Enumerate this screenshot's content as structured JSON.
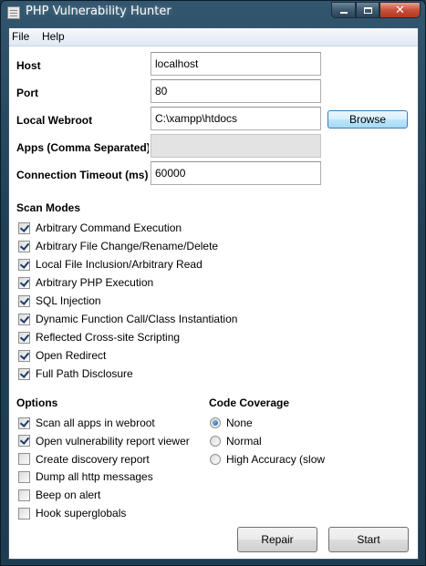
{
  "window": {
    "title": "PHP Vulnerability Hunter"
  },
  "menu": {
    "file": "File",
    "help": "Help"
  },
  "form": {
    "host_label": "Host",
    "host_value": "localhost",
    "port_label": "Port",
    "port_value": "80",
    "webroot_label": "Local Webroot",
    "webroot_value": "C:\\xampp\\htdocs",
    "browse_label": "Browse",
    "apps_label": "Apps (Comma Separated)",
    "apps_value": "",
    "timeout_label": "Connection Timeout (ms)",
    "timeout_value": "60000"
  },
  "scan_modes": {
    "heading": "Scan Modes",
    "items": [
      {
        "label": "Arbitrary Command Execution",
        "checked": true
      },
      {
        "label": "Arbitrary File Change/Rename/Delete",
        "checked": true
      },
      {
        "label": "Local File Inclusion/Arbitrary Read",
        "checked": true
      },
      {
        "label": "Arbitrary PHP Execution",
        "checked": true
      },
      {
        "label": "SQL Injection",
        "checked": true
      },
      {
        "label": "Dynamic Function Call/Class Instantiation",
        "checked": true
      },
      {
        "label": "Reflected Cross-site Scripting",
        "checked": true
      },
      {
        "label": "Open Redirect",
        "checked": true
      },
      {
        "label": "Full Path Disclosure",
        "checked": true
      }
    ]
  },
  "options": {
    "heading": "Options",
    "items": [
      {
        "label": "Scan all apps in webroot",
        "checked": true
      },
      {
        "label": "Open vulnerability report viewer",
        "checked": true
      },
      {
        "label": "Create discovery report",
        "checked": false
      },
      {
        "label": "Dump all http messages",
        "checked": false
      },
      {
        "label": "Beep on alert",
        "checked": false
      },
      {
        "label": "Hook superglobals",
        "checked": false
      }
    ]
  },
  "code_coverage": {
    "heading": "Code Coverage",
    "items": [
      {
        "label": "None",
        "selected": true
      },
      {
        "label": "Normal",
        "selected": false
      },
      {
        "label": "High Accuracy (slow",
        "selected": false
      }
    ]
  },
  "buttons": {
    "repair": "Repair",
    "start": "Start"
  }
}
